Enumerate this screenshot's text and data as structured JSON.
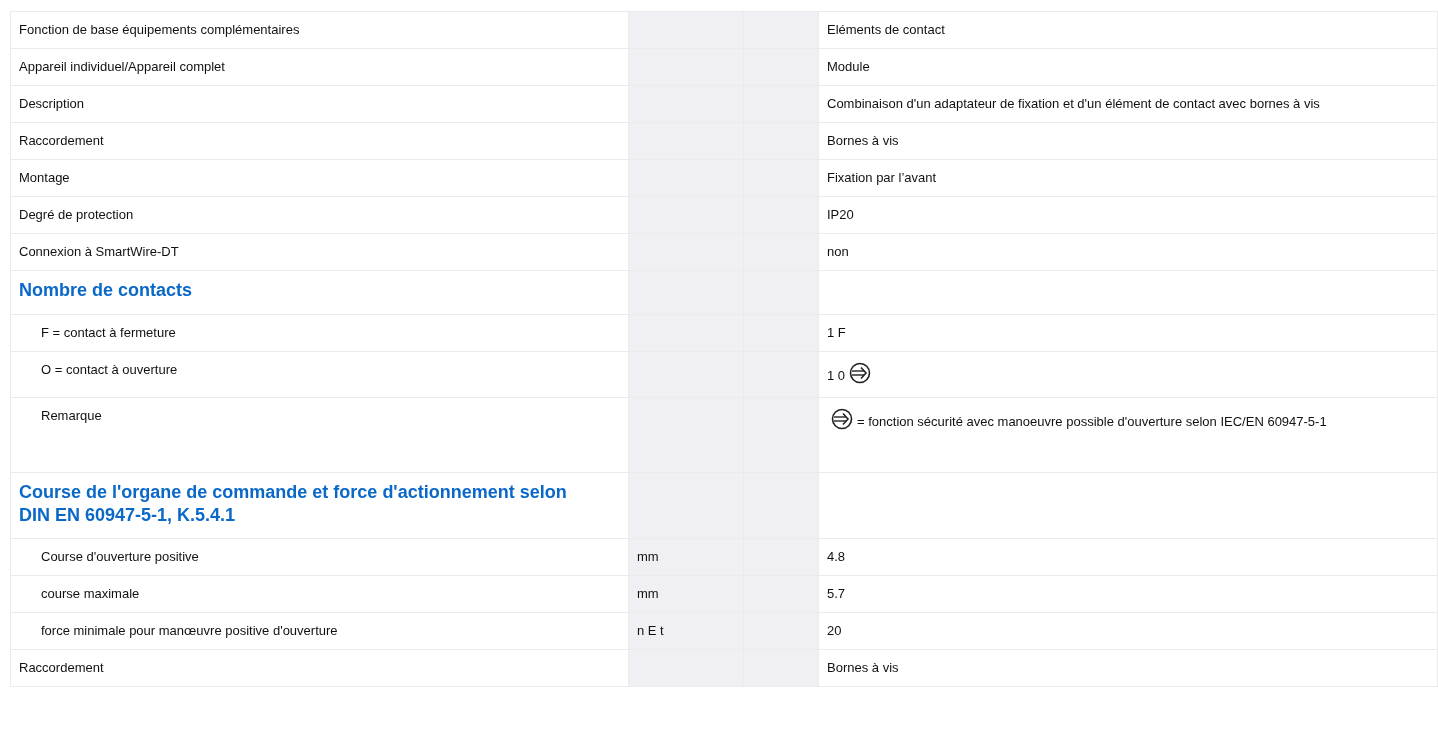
{
  "rows": [
    {
      "kind": "row",
      "label": "Fonction de base équipements complémentaires",
      "value": "Eléments de contact"
    },
    {
      "kind": "row",
      "label": "Appareil individuel/Appareil complet",
      "value": "Module"
    },
    {
      "kind": "row",
      "label": "Description",
      "value": "Combinaison d'un adaptateur de fixation et d'un élément de contact avec bornes à vis"
    },
    {
      "kind": "row",
      "label": "Raccordement",
      "value": "Bornes à vis"
    },
    {
      "kind": "row",
      "label": "Montage",
      "value": "Fixation par l’avant"
    },
    {
      "kind": "row",
      "label": "Degré de protection",
      "value": "IP20"
    },
    {
      "kind": "row",
      "label": "Connexion à SmartWire-DT",
      "value": "non"
    },
    {
      "kind": "section",
      "label": "Nombre de contacts"
    },
    {
      "kind": "subrow",
      "label": "F = contact à fermeture",
      "value": "1 F"
    },
    {
      "kind": "subrow",
      "label": "O = contact à ouverture",
      "value_parts": [
        {
          "kind": "text",
          "text": "1 0"
        },
        {
          "kind": "safety-icon"
        }
      ]
    },
    {
      "kind": "subrow",
      "label": "Remarque",
      "value_parts": [
        {
          "kind": "safety-icon"
        },
        {
          "kind": "text",
          "text": "= fonction sécurité avec manoeuvre possible d'ouverture selon IEC/EN 60947-5-1"
        }
      ]
    },
    {
      "kind": "section",
      "label": "Course de l'organe de commande et force d'actionnement selon DIN EN 60947-5-1, K.5.4.1"
    },
    {
      "kind": "subrow",
      "label": "Course d'ouverture positive",
      "unit": "mm",
      "value": "4.8"
    },
    {
      "kind": "subrow",
      "label": "course maximale",
      "unit": "mm",
      "value": "5.7"
    },
    {
      "kind": "subrow",
      "label": "force minimale pour manœuvre positive d'ouverture",
      "unit": "n E t",
      "value": "20"
    },
    {
      "kind": "row",
      "label": "Raccordement",
      "value": "Bornes à vis"
    }
  ]
}
